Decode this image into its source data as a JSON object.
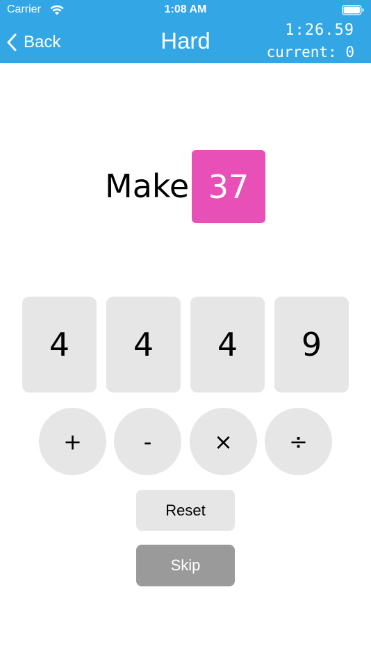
{
  "status_bar": {
    "carrier": "Carrier",
    "time": "1:08 AM",
    "wifi_icon": "wifi-icon",
    "battery_icon": "battery-icon"
  },
  "nav": {
    "back_label": "Back",
    "title": "Hard",
    "timer": "1:26.59",
    "current_label": "current:",
    "current_value": "0"
  },
  "puzzle": {
    "make_label": "Make",
    "target": "37",
    "numbers": [
      "4",
      "4",
      "4",
      "9"
    ],
    "operators": [
      "+",
      "-",
      "×",
      "÷"
    ]
  },
  "actions": {
    "reset_label": "Reset",
    "skip_label": "Skip"
  },
  "colors": {
    "header_bg": "#33a7e6",
    "target_bg": "#e84fb7",
    "card_bg": "#e6e6e6",
    "skip_bg": "#9a9a9a"
  }
}
